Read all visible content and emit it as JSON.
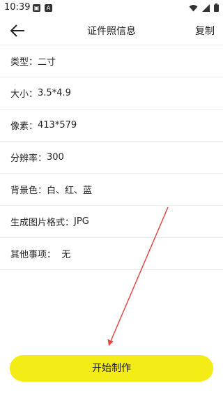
{
  "status_bar": {
    "time": "10:39",
    "left_icons": [
      "image-icon",
      "a-icon"
    ],
    "right_icons": [
      "wifi-icon",
      "signal-icon",
      "battery-icon"
    ]
  },
  "app_bar": {
    "back_icon": "back-arrow-icon",
    "title": "证件照信息",
    "copy_label": "复制"
  },
  "info": {
    "rows": [
      {
        "label": "类型：",
        "value": "二寸"
      },
      {
        "label": "大小：",
        "value": "3.5*4.9"
      },
      {
        "label": "像素：",
        "value": "413*579"
      },
      {
        "label": "分辨率：",
        "value": "300"
      },
      {
        "label": "背景色：",
        "value": "白、红、蓝"
      },
      {
        "label": "生成图片格式：",
        "value": "JPG"
      },
      {
        "label": "其他事项：",
        "value": "  无"
      }
    ]
  },
  "annotation": {
    "color": "#e04848"
  },
  "footer": {
    "start_label": "开始制作",
    "button_color": "#f4ec17"
  }
}
